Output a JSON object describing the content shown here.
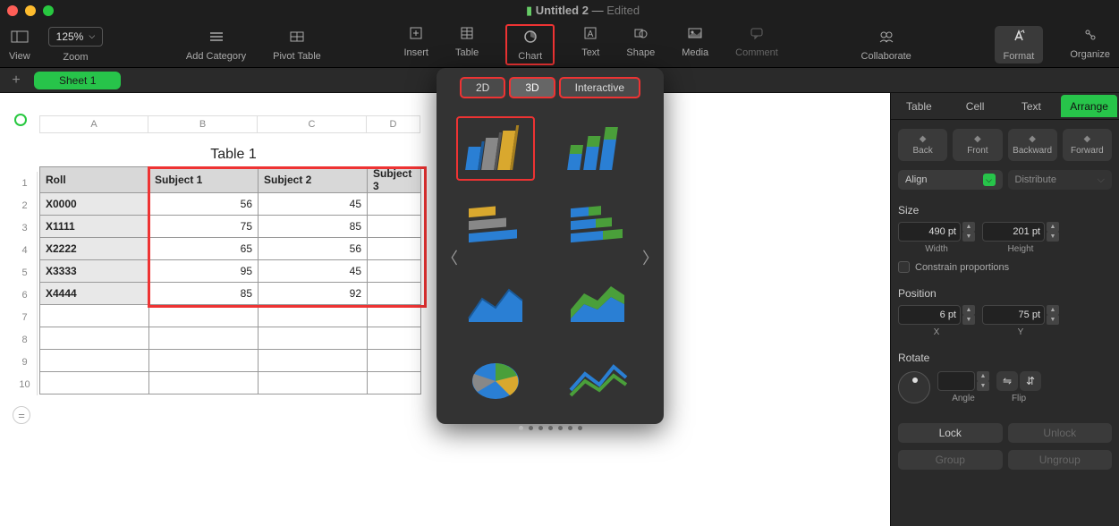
{
  "window": {
    "title": "Untitled 2",
    "state": "Edited"
  },
  "toolbar": {
    "view": "View",
    "zoom_value": "125%",
    "zoom_label": "Zoom",
    "add_category": "Add Category",
    "pivot_table": "Pivot Table",
    "insert": "Insert",
    "table": "Table",
    "chart": "Chart",
    "text": "Text",
    "shape": "Shape",
    "media": "Media",
    "comment": "Comment",
    "collaborate": "Collaborate",
    "format": "Format",
    "organize": "Organize"
  },
  "sheets": {
    "tab1": "Sheet 1"
  },
  "columns": [
    "A",
    "B",
    "C",
    "D"
  ],
  "rows": [
    "1",
    "2",
    "3",
    "4",
    "5",
    "6",
    "7",
    "8",
    "9",
    "10"
  ],
  "table": {
    "title": "Table 1",
    "headers": [
      "Roll",
      "Subject 1",
      "Subject 2",
      "Subject 3"
    ],
    "data": [
      [
        "X0000",
        "56",
        "45",
        ""
      ],
      [
        "X1111",
        "75",
        "85",
        ""
      ],
      [
        "X2222",
        "65",
        "56",
        ""
      ],
      [
        "X3333",
        "95",
        "45",
        ""
      ],
      [
        "X4444",
        "85",
        "92",
        ""
      ]
    ]
  },
  "chart_popover": {
    "tabs": [
      "2D",
      "3D",
      "Interactive"
    ],
    "active_tab": 1,
    "items": [
      "3d-column",
      "3d-stacked-column",
      "3d-bar",
      "3d-stacked-bar",
      "3d-area",
      "3d-stacked-area",
      "3d-pie",
      "3d-line"
    ],
    "dots": 7
  },
  "inspector": {
    "tabs": [
      "Table",
      "Cell",
      "Text",
      "Arrange"
    ],
    "active_tab": 3,
    "back": "Back",
    "front": "Front",
    "backward": "Backward",
    "forward": "Forward",
    "align": "Align",
    "distribute": "Distribute",
    "size_label": "Size",
    "width": "490 pt",
    "width_label": "Width",
    "height": "201 pt",
    "height_label": "Height",
    "constrain": "Constrain proportions",
    "position_label": "Position",
    "x": "6 pt",
    "x_label": "X",
    "y": "75 pt",
    "y_label": "Y",
    "rotate_label": "Rotate",
    "angle_label": "Angle",
    "flip_label": "Flip",
    "lock": "Lock",
    "unlock": "Unlock",
    "group": "Group",
    "ungroup": "Ungroup"
  }
}
